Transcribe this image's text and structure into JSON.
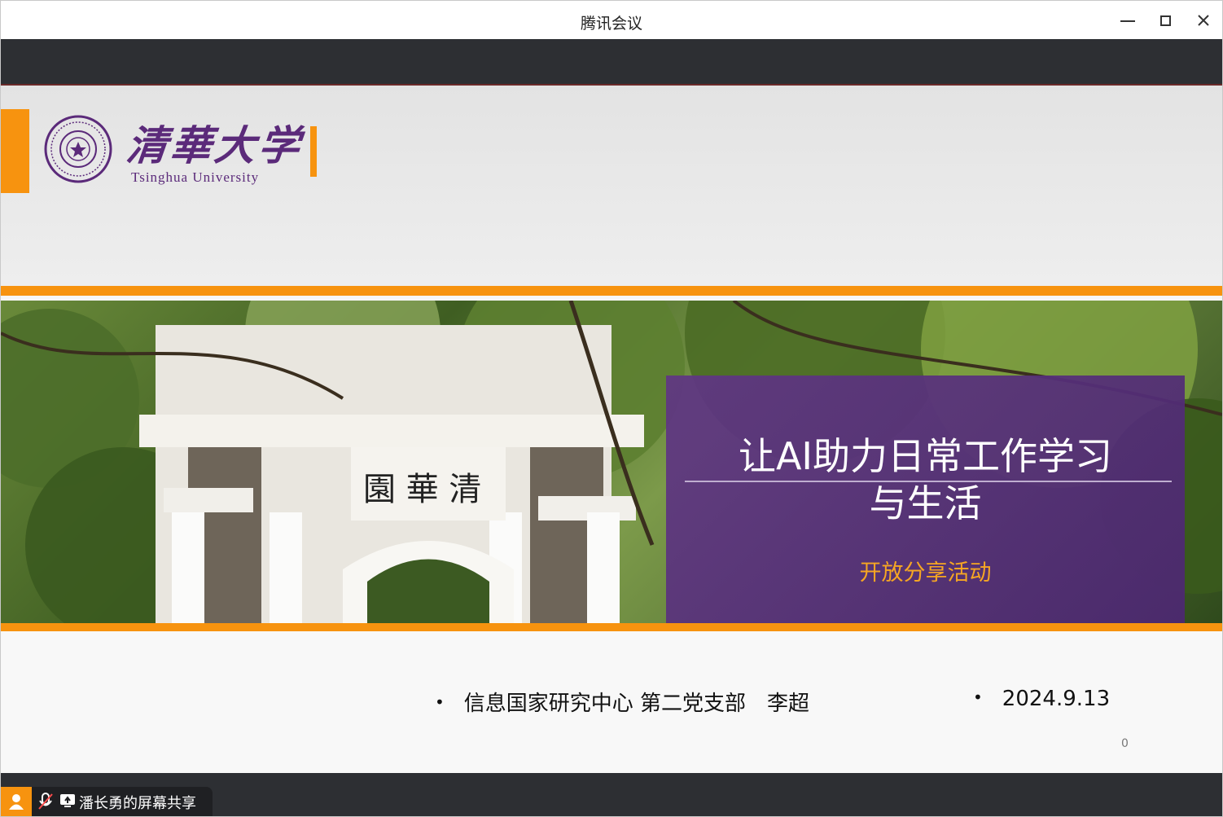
{
  "window": {
    "title": "腾讯会议"
  },
  "slide": {
    "logo": {
      "chinese": "清華大学",
      "english": "Tsinghua University"
    },
    "title_line1": "让AI助力日常工作学习",
    "title_line2": "与生活",
    "subtitle": "开放分享活动",
    "bullets": {
      "author": "信息国家研究中心 第二党支部　李超",
      "date": "2024.9.13"
    },
    "page_number": "0",
    "colors": {
      "accent_orange": "#f7930f",
      "purple": "#5b2a7a",
      "subtitle_gold": "#f6a623"
    }
  },
  "bottom_bar": {
    "share_label": "潘长勇的屏幕共享",
    "icons": [
      "user-icon",
      "mic-muted-icon",
      "screen-share-icon"
    ]
  }
}
